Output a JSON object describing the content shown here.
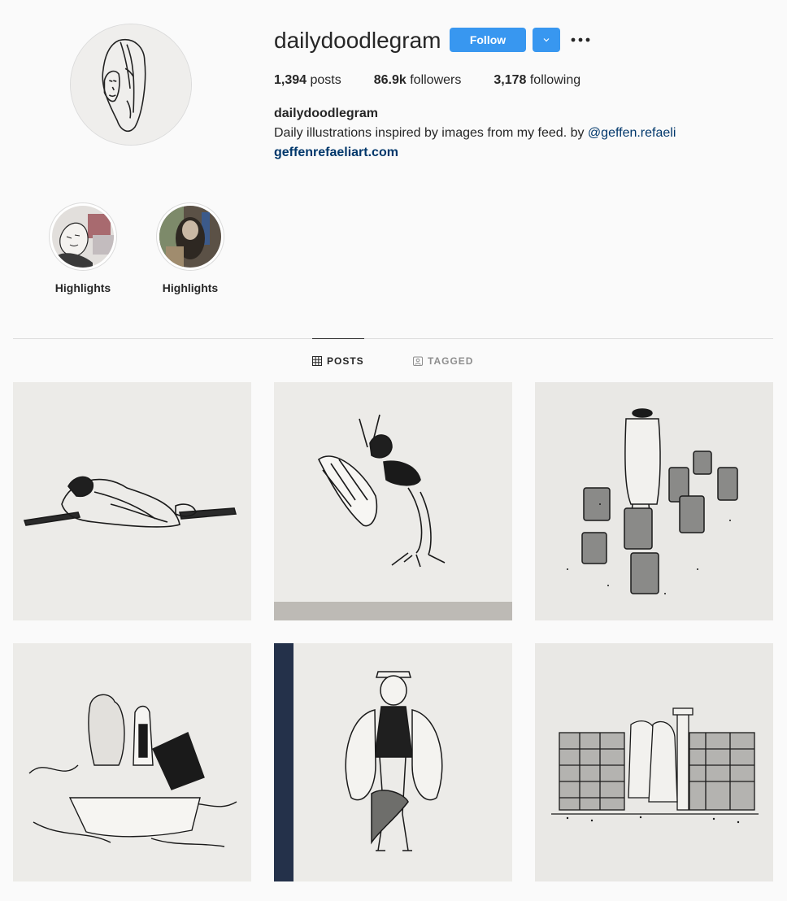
{
  "profile": {
    "username": "dailydoodlegram",
    "follow_label": "Follow",
    "dropdown_icon": "chevron-down-icon",
    "more_icon": "ellipsis-icon",
    "stats": {
      "posts_count": "1,394",
      "posts_label": " posts",
      "followers_count": "86.9k",
      "followers_label": " followers",
      "following_count": "3,178",
      "following_label": " following"
    },
    "full_name": "dailydoodlegram",
    "bio_text": "Daily illustrations inspired by images from my feed. by ",
    "bio_mention": "@geffen.refaeli",
    "website": "geffenrefaeliart.com"
  },
  "highlights": [
    {
      "label": "Highlights"
    },
    {
      "label": "Highlights"
    }
  ],
  "tabs": [
    {
      "label": "POSTS",
      "icon": "grid-icon",
      "active": true
    },
    {
      "label": "TAGGED",
      "icon": "tagged-icon",
      "active": false
    }
  ],
  "colors": {
    "accent": "#3897f0",
    "link": "#00376b",
    "text": "#262626",
    "muted": "#8e8e8e",
    "background": "#fafafa"
  },
  "posts": [
    {
      "subject": "sleeping figure on a bar"
    },
    {
      "subject": "woman with grasshopper"
    },
    {
      "subject": "man among stone stumps"
    },
    {
      "subject": "bear and man in a boat"
    },
    {
      "subject": "man holding a bird"
    },
    {
      "subject": "figures by ruined columns"
    }
  ]
}
